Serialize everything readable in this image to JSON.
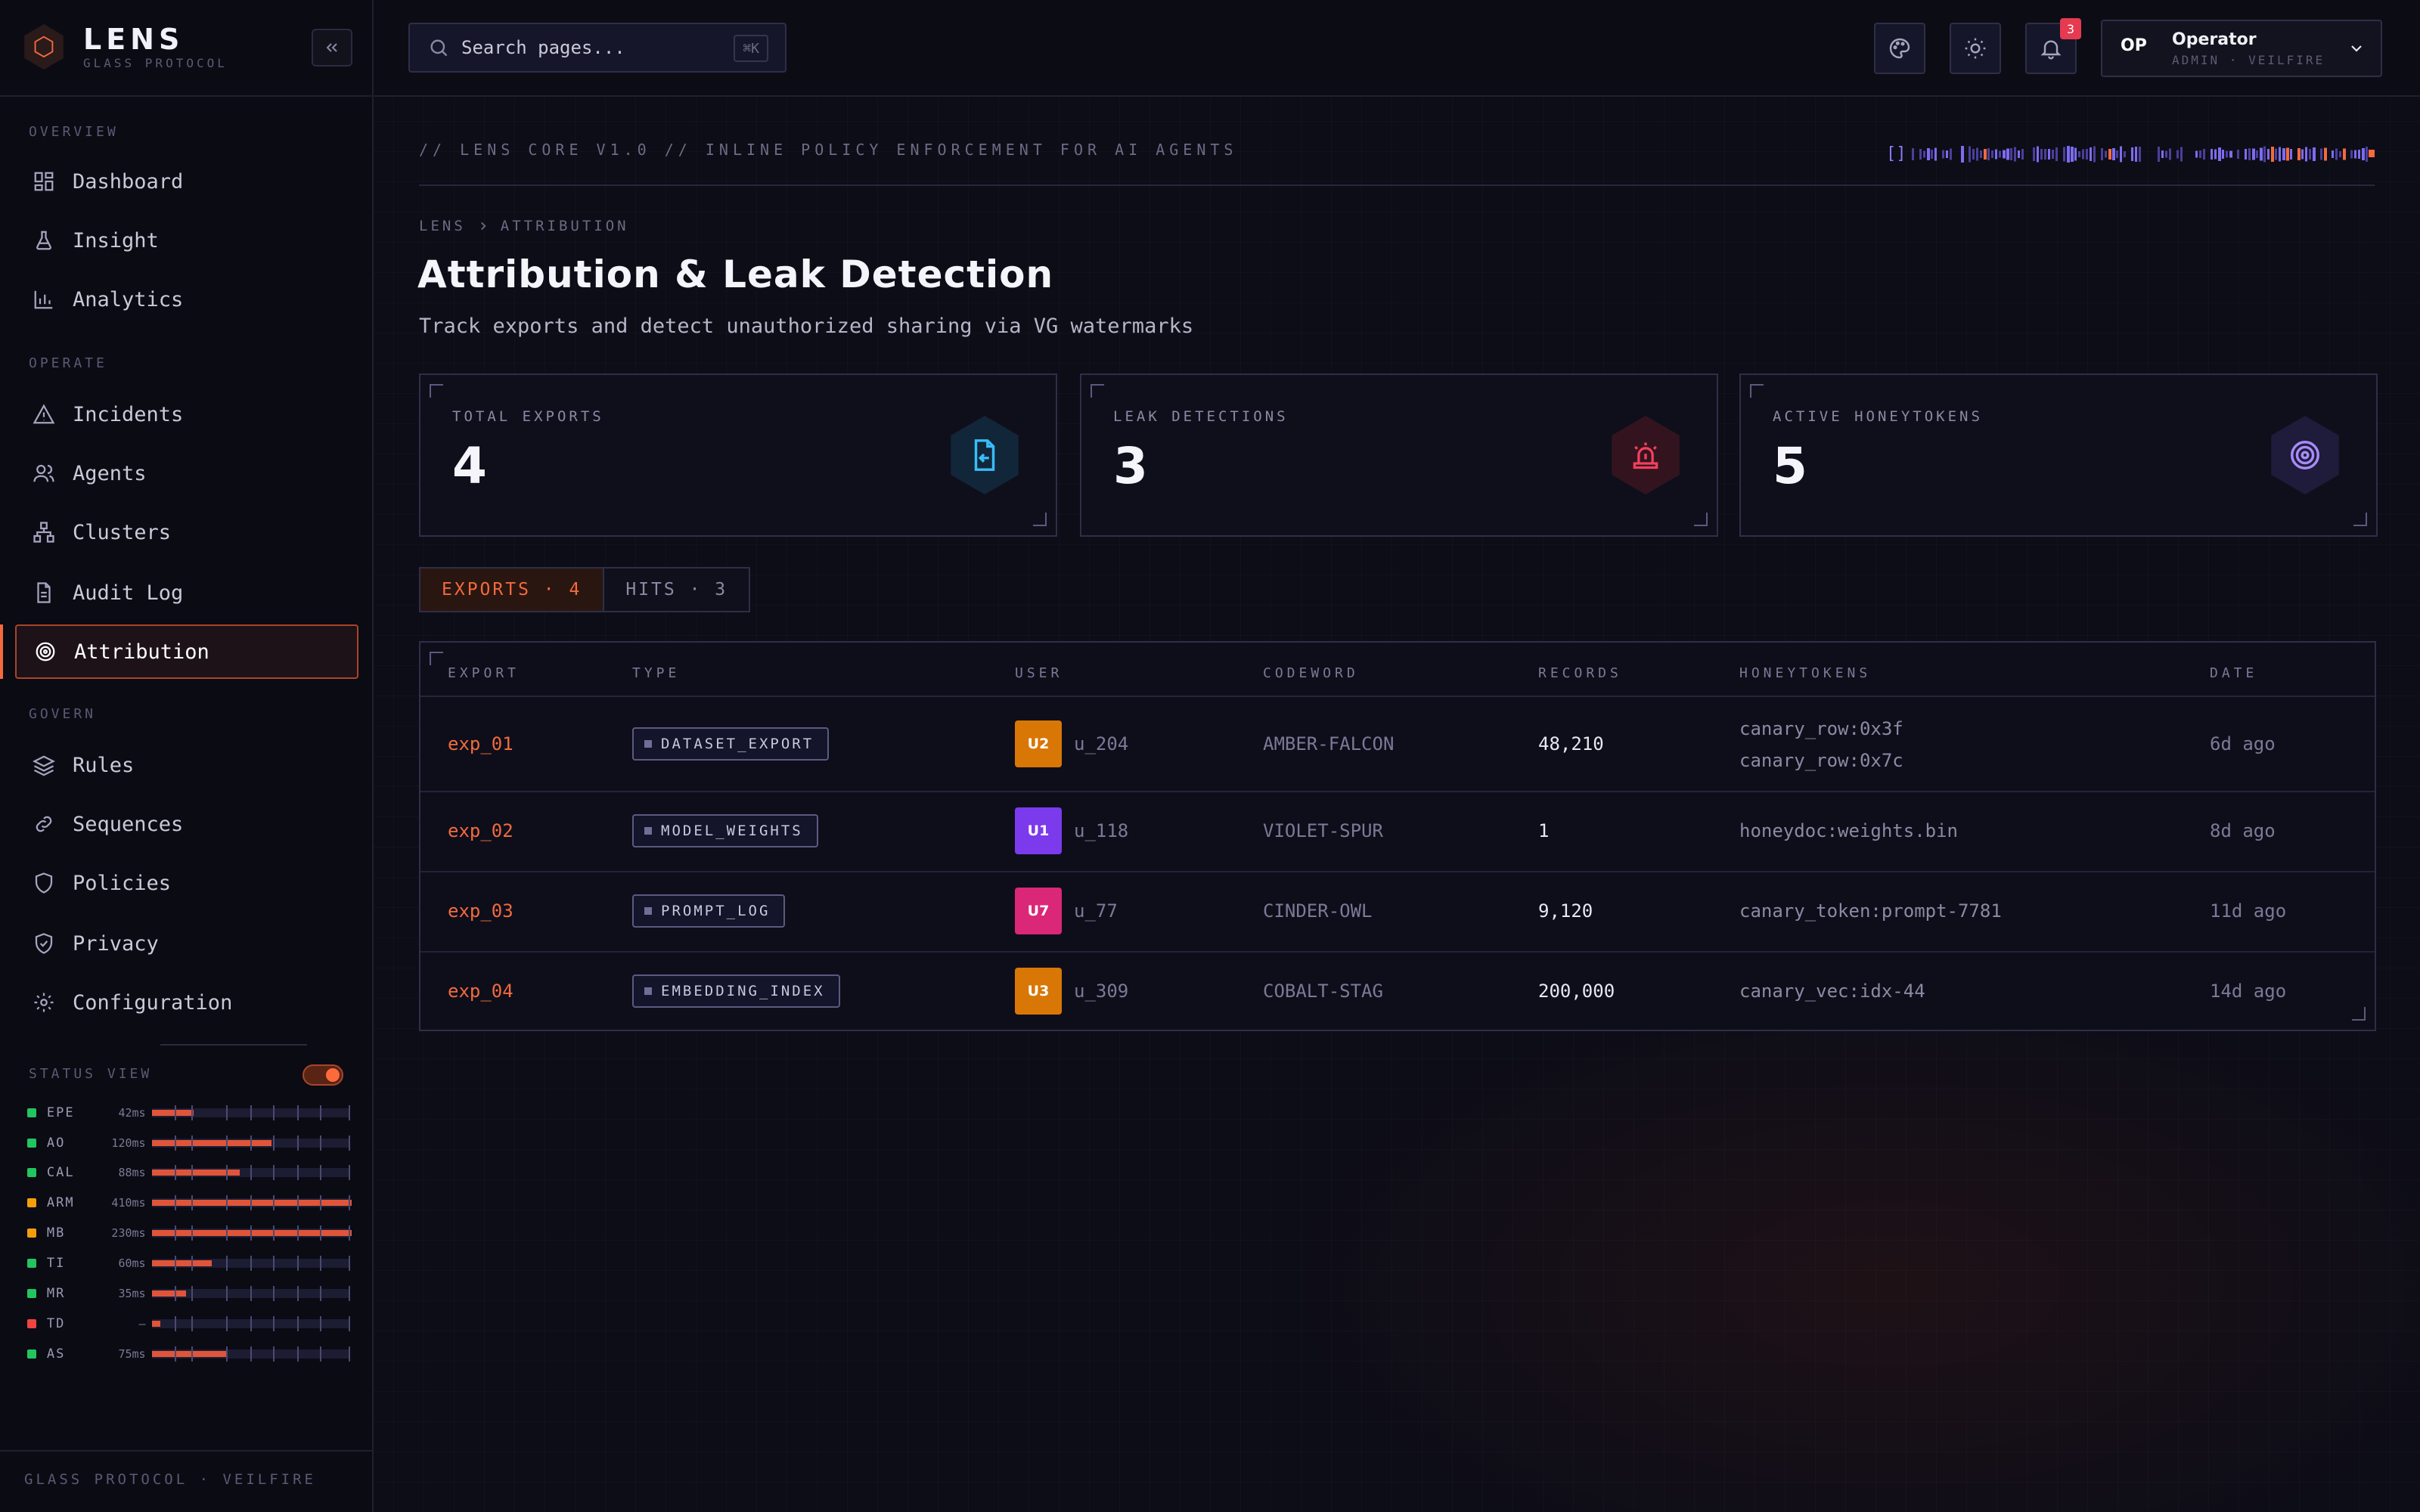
{
  "brand": {
    "name": "LENS",
    "subtitle": "GLASS PROTOCOL"
  },
  "sidebar": {
    "sections": [
      {
        "label": "OVERVIEW",
        "items": [
          {
            "label": "Dashboard",
            "icon": "dashboard-icon"
          },
          {
            "label": "Insight",
            "icon": "flask-icon"
          },
          {
            "label": "Analytics",
            "icon": "bar-chart-icon"
          }
        ]
      },
      {
        "label": "OPERATE",
        "items": [
          {
            "label": "Incidents",
            "icon": "alert-triangle-icon"
          },
          {
            "label": "Agents",
            "icon": "users-icon"
          },
          {
            "label": "Clusters",
            "icon": "network-icon"
          },
          {
            "label": "Audit Log",
            "icon": "document-icon"
          },
          {
            "label": "Attribution",
            "icon": "target-icon",
            "active": true
          }
        ]
      },
      {
        "label": "GOVERN",
        "items": [
          {
            "label": "Rules",
            "icon": "layers-icon"
          },
          {
            "label": "Sequences",
            "icon": "link-icon"
          },
          {
            "label": "Policies",
            "icon": "shield-icon"
          },
          {
            "label": "Privacy",
            "icon": "shield-check-icon"
          },
          {
            "label": "Configuration",
            "icon": "gear-icon"
          }
        ]
      }
    ],
    "status_view": {
      "label": "STATUS VIEW",
      "enabled": true,
      "rows": [
        {
          "code": "EPE",
          "ms": "42ms",
          "status": "ok",
          "level": 0.21
        },
        {
          "code": "AO",
          "ms": "120ms",
          "status": "ok",
          "level": 0.6
        },
        {
          "code": "CAL",
          "ms": "88ms",
          "status": "ok",
          "level": 0.44
        },
        {
          "code": "ARM",
          "ms": "410ms",
          "status": "warn",
          "level": 1.0
        },
        {
          "code": "MB",
          "ms": "230ms",
          "status": "warn",
          "level": 1.0
        },
        {
          "code": "TI",
          "ms": "60ms",
          "status": "ok",
          "level": 0.3
        },
        {
          "code": "MR",
          "ms": "35ms",
          "status": "ok",
          "level": 0.17
        },
        {
          "code": "TD",
          "ms": "—",
          "status": "down",
          "level": 0.04
        },
        {
          "code": "AS",
          "ms": "75ms",
          "status": "ok",
          "level": 0.37
        }
      ]
    },
    "footer": "GLASS PROTOCOL · VEILFIRE"
  },
  "topbar": {
    "search_placeholder": "Search pages...",
    "search_shortcut": "⌘K",
    "notification_count": "3",
    "user": {
      "initials": "OP",
      "name": "Operator",
      "role": "ADMIN · VEILFIRE"
    }
  },
  "header": {
    "ticker": "// LENS CORE V1.0  //  INLINE POLICY ENFORCEMENT FOR AI AGENTS",
    "ticker_bracket": "[]"
  },
  "breadcrumb": [
    "LENS",
    "ATTRIBUTION"
  ],
  "page": {
    "title": "Attribution & Leak Detection",
    "subtitle": "Track exports and detect unauthorized sharing via VG watermarks"
  },
  "stats": [
    {
      "label": "TOTAL EXPORTS",
      "value": "4",
      "icon": "export-file-icon",
      "color": "#38bdf8"
    },
    {
      "label": "LEAK DETECTIONS",
      "value": "3",
      "icon": "siren-icon",
      "color": "#f43f5e"
    },
    {
      "label": "ACTIVE HONEYTOKENS",
      "value": "5",
      "icon": "target-icon",
      "color": "#a78bfa"
    }
  ],
  "tabs": [
    {
      "label": "EXPORTS · 4",
      "active": true
    },
    {
      "label": "HITS · 3",
      "active": false
    }
  ],
  "table": {
    "columns": [
      "EXPORT",
      "TYPE",
      "USER",
      "CODEWORD",
      "RECORDS",
      "HONEYTOKENS",
      "DATE"
    ],
    "rows": [
      {
        "export": "exp_01",
        "type": "DATASET_EXPORT",
        "avatar": "U2",
        "avatar_color": "#d97706",
        "user": "u_204",
        "codeword": "AMBER-FALCON",
        "records": "48,210",
        "honeytokens": [
          "canary_row:0x3f",
          "canary_row:0x7c"
        ],
        "date": "6d ago"
      },
      {
        "export": "exp_02",
        "type": "MODEL_WEIGHTS",
        "avatar": "U1",
        "avatar_color": "#7c3aed",
        "user": "u_118",
        "codeword": "VIOLET-SPUR",
        "records": "1",
        "honeytokens": [
          "honeydoc:weights.bin"
        ],
        "date": "8d ago"
      },
      {
        "export": "exp_03",
        "type": "PROMPT_LOG",
        "avatar": "U7",
        "avatar_color": "#db2777",
        "user": "u_77",
        "codeword": "CINDER-OWL",
        "records": "9,120",
        "honeytokens": [
          "canary_token:prompt-7781"
        ],
        "date": "11d ago"
      },
      {
        "export": "exp_04",
        "type": "EMBEDDING_INDEX",
        "avatar": "U3",
        "avatar_color": "#d97706",
        "user": "u_309",
        "codeword": "COBALT-STAG",
        "records": "200,000",
        "honeytokens": [
          "canary_vec:idx-44"
        ],
        "date": "14d ago"
      }
    ]
  },
  "colors": {
    "accent": "#f26a3d",
    "ok": "#22c55e",
    "warn": "#f59e0b",
    "down": "#ef4444"
  }
}
